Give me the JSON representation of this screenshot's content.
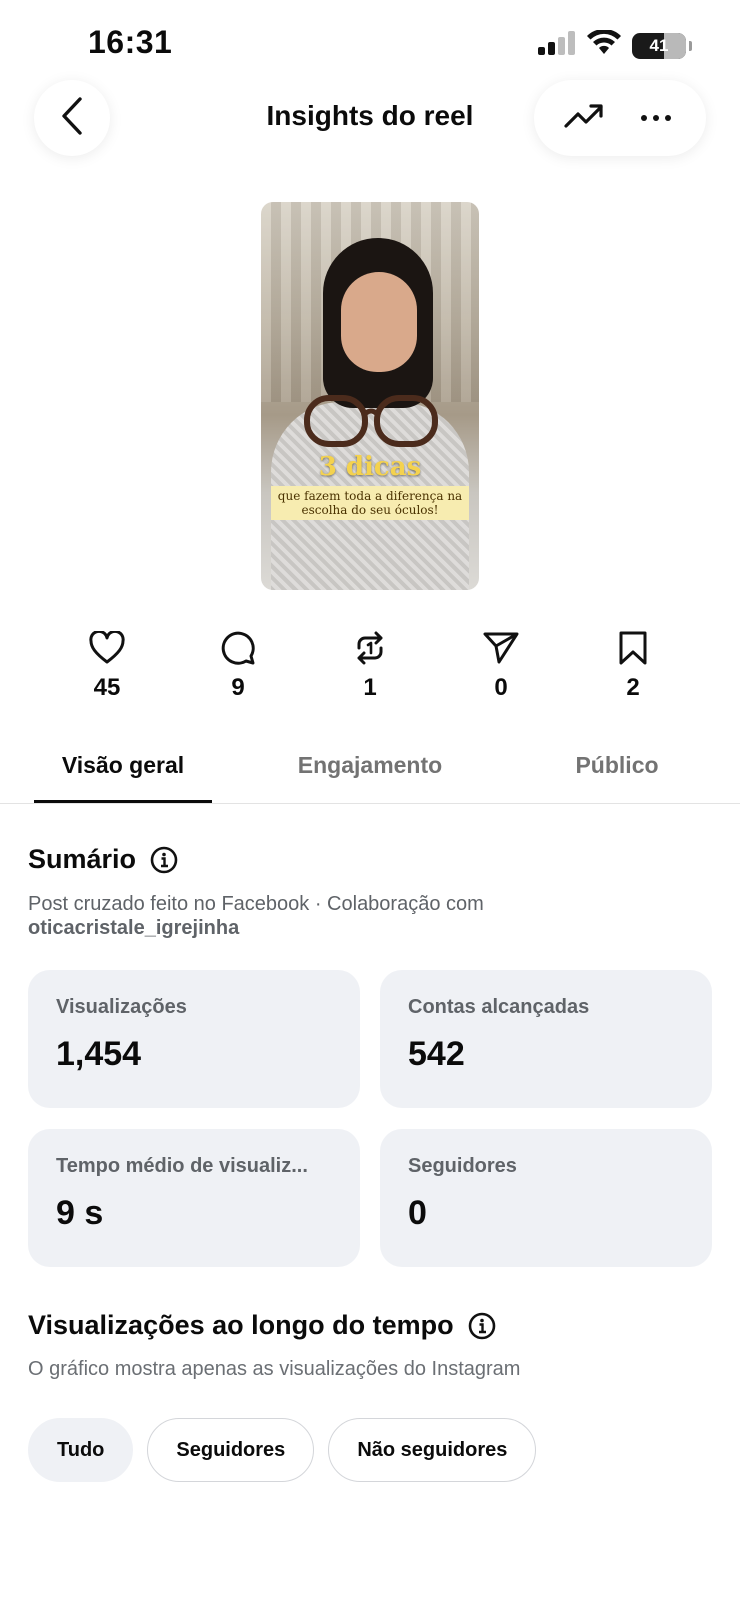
{
  "status_bar": {
    "time": "16:31",
    "battery": "41"
  },
  "header": {
    "title": "Insights do reel"
  },
  "thumbnail": {
    "headline": "3 dicas",
    "subline": "que fazem toda a diferença na escolha do seu óculos!"
  },
  "metrics": [
    {
      "icon": "heart-icon",
      "value": "45"
    },
    {
      "icon": "comment-icon",
      "value": "9"
    },
    {
      "icon": "repost-icon",
      "value": "1"
    },
    {
      "icon": "share-icon",
      "value": "0"
    },
    {
      "icon": "bookmark-icon",
      "value": "2"
    }
  ],
  "tabs": [
    {
      "label": "Visão geral",
      "active": true
    },
    {
      "label": "Engajamento",
      "active": false
    },
    {
      "label": "Público",
      "active": false
    }
  ],
  "summary": {
    "title": "Sumário",
    "subtitle": "Post cruzado feito no Facebook · Colaboração com",
    "handle": "oticacristale_igrejinha",
    "cards": [
      {
        "label": "Visualizações",
        "value": "1,454"
      },
      {
        "label": "Contas alcançadas",
        "value": "542"
      },
      {
        "label": "Tempo médio de visualiz...",
        "value": "9 s"
      },
      {
        "label": "Seguidores",
        "value": "0"
      }
    ]
  },
  "views_over_time": {
    "title": "Visualizações ao longo do tempo",
    "subtitle": "O gráfico mostra apenas as visualizações do Instagram",
    "filters": [
      {
        "label": "Tudo",
        "selected": true
      },
      {
        "label": "Seguidores",
        "selected": false
      },
      {
        "label": "Não seguidores",
        "selected": false
      }
    ]
  },
  "colors": {
    "card_bg": "#eff1f5",
    "muted_text": "#5f6368",
    "active_tab": "#0b0b0b"
  }
}
